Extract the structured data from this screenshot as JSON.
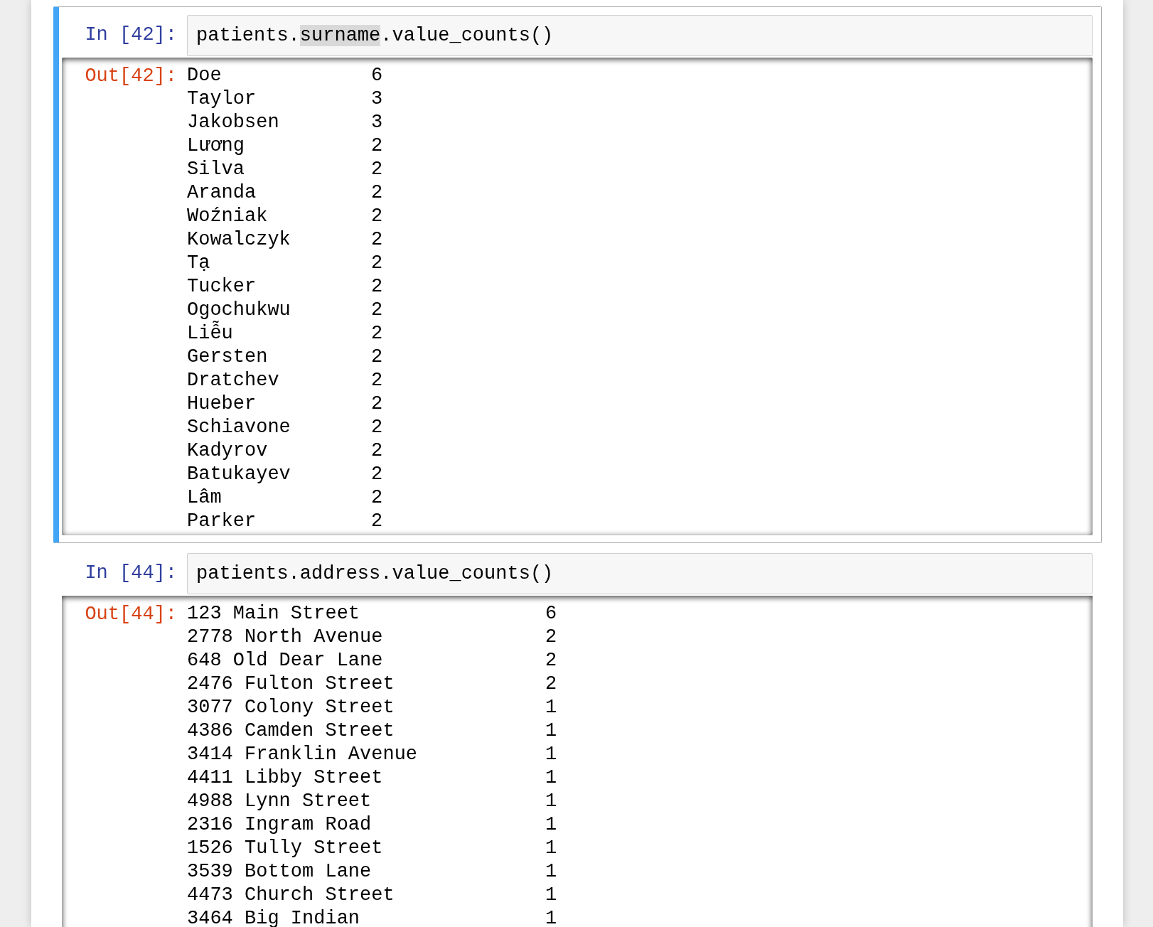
{
  "cells": [
    {
      "selected": true,
      "in_prompt": "In [42]:",
      "code": [
        {
          "text": "patients.",
          "highlighted": false
        },
        {
          "text": "surname",
          "highlighted": true
        },
        {
          "text": ".value_counts()",
          "highlighted": false
        }
      ],
      "out_prompt": "Out[42]:",
      "scrolled": true,
      "rows": [
        {
          "label": "Doe",
          "count": "6"
        },
        {
          "label": "Taylor",
          "count": "3"
        },
        {
          "label": "Jakobsen",
          "count": "3"
        },
        {
          "label": "Lương",
          "count": "2"
        },
        {
          "label": "Silva",
          "count": "2"
        },
        {
          "label": "Aranda",
          "count": "2"
        },
        {
          "label": "Woźniak",
          "count": "2"
        },
        {
          "label": "Kowalczyk",
          "count": "2"
        },
        {
          "label": "Tạ",
          "count": "2"
        },
        {
          "label": "Tucker",
          "count": "2"
        },
        {
          "label": "Ogochukwu",
          "count": "2"
        },
        {
          "label": "Liễu",
          "count": "2"
        },
        {
          "label": "Gersten",
          "count": "2"
        },
        {
          "label": "Dratchev",
          "count": "2"
        },
        {
          "label": "Hueber",
          "count": "2"
        },
        {
          "label": "Schiavone",
          "count": "2"
        },
        {
          "label": "Kadyrov",
          "count": "2"
        },
        {
          "label": "Batukayev",
          "count": "2"
        },
        {
          "label": "Lâm",
          "count": "2"
        },
        {
          "label": "Parker",
          "count": "2"
        }
      ]
    },
    {
      "selected": false,
      "in_prompt": "In [44]:",
      "code": [
        {
          "text": "patients.address.value_counts()",
          "highlighted": false
        }
      ],
      "out_prompt": "Out[44]:",
      "scrolled": false,
      "rows": [
        {
          "label": "123 Main Street",
          "count": "6"
        },
        {
          "label": "2778 North Avenue",
          "count": "2"
        },
        {
          "label": "648 Old Dear Lane",
          "count": "2"
        },
        {
          "label": "2476 Fulton Street",
          "count": "2"
        },
        {
          "label": "3077 Colony Street",
          "count": "1"
        },
        {
          "label": "4386 Camden Street",
          "count": "1"
        },
        {
          "label": "3414 Franklin Avenue",
          "count": "1"
        },
        {
          "label": "4411 Libby Street",
          "count": "1"
        },
        {
          "label": "4988 Lynn Street",
          "count": "1"
        },
        {
          "label": "2316 Ingram Road",
          "count": "1"
        },
        {
          "label": "1526 Tully Street",
          "count": "1"
        },
        {
          "label": "3539 Bottom Lane",
          "count": "1"
        },
        {
          "label": "4473 Church Street",
          "count": "1"
        },
        {
          "label": "3464 Big Indian",
          "count": "1"
        }
      ]
    }
  ]
}
